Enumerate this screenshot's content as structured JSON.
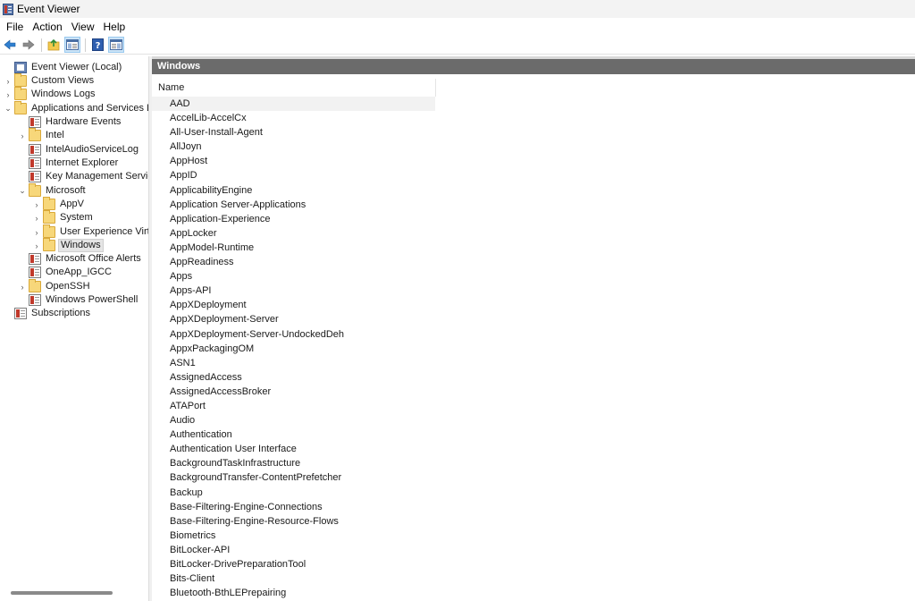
{
  "window": {
    "title": "Event Viewer",
    "icon": "event-viewer-icon"
  },
  "menu": [
    "File",
    "Action",
    "View",
    "Help"
  ],
  "toolbar": {
    "buttons": [
      "back-arrow-icon",
      "forward-arrow-icon",
      "up-folder-icon",
      "show-hide-tree-icon",
      "help-icon",
      "show-hide-action-pane-icon"
    ]
  },
  "tree": [
    {
      "label": "Event Viewer (Local)",
      "indent": 0,
      "expander": "",
      "icon": "event-viewer-icon"
    },
    {
      "label": "Custom Views",
      "indent": 0,
      "expander": "›",
      "icon": "folder-icon"
    },
    {
      "label": "Windows Logs",
      "indent": 0,
      "expander": "›",
      "icon": "folder-icon"
    },
    {
      "label": "Applications and Services Logs",
      "indent": 0,
      "expander": "⌄",
      "icon": "folder-icon"
    },
    {
      "label": "Hardware Events",
      "indent": 1,
      "expander": "",
      "icon": "log-icon"
    },
    {
      "label": "Intel",
      "indent": 1,
      "expander": "›",
      "icon": "folder-icon"
    },
    {
      "label": "IntelAudioServiceLog",
      "indent": 1,
      "expander": "",
      "icon": "log-icon"
    },
    {
      "label": "Internet Explorer",
      "indent": 1,
      "expander": "",
      "icon": "log-icon"
    },
    {
      "label": "Key Management Service",
      "indent": 1,
      "expander": "",
      "icon": "log-icon"
    },
    {
      "label": "Microsoft",
      "indent": 1,
      "expander": "⌄",
      "icon": "folder-icon"
    },
    {
      "label": "AppV",
      "indent": 2,
      "expander": "›",
      "icon": "folder-icon"
    },
    {
      "label": "System",
      "indent": 2,
      "expander": "›",
      "icon": "folder-icon"
    },
    {
      "label": "User Experience Virtualization",
      "indent": 2,
      "expander": "›",
      "icon": "folder-icon"
    },
    {
      "label": "Windows",
      "indent": 2,
      "expander": "›",
      "icon": "folder-icon",
      "selected": true
    },
    {
      "label": "Microsoft Office Alerts",
      "indent": 1,
      "expander": "",
      "icon": "log-icon"
    },
    {
      "label": "OneApp_IGCC",
      "indent": 1,
      "expander": "",
      "icon": "log-icon"
    },
    {
      "label": "OpenSSH",
      "indent": 1,
      "expander": "›",
      "icon": "folder-icon"
    },
    {
      "label": "Windows PowerShell",
      "indent": 1,
      "expander": "",
      "icon": "log-icon"
    },
    {
      "label": "Subscriptions",
      "indent": 0,
      "expander": "",
      "icon": "subscriptions-icon"
    }
  ],
  "content": {
    "header": "Windows",
    "column_name": "Name",
    "items": [
      "AAD",
      "AccelLib-AccelCx",
      "All-User-Install-Agent",
      "AllJoyn",
      "AppHost",
      "AppID",
      "ApplicabilityEngine",
      "Application Server-Applications",
      "Application-Experience",
      "AppLocker",
      "AppModel-Runtime",
      "AppReadiness",
      "Apps",
      "Apps-API",
      "AppXDeployment",
      "AppXDeployment-Server",
      "AppXDeployment-Server-UndockedDeh",
      "AppxPackagingOM",
      "ASN1",
      "AssignedAccess",
      "AssignedAccessBroker",
      "ATAPort",
      "Audio",
      "Authentication",
      "Authentication User Interface",
      "BackgroundTaskInfrastructure",
      "BackgroundTransfer-ContentPrefetcher",
      "Backup",
      "Base-Filtering-Engine-Connections",
      "Base-Filtering-Engine-Resource-Flows",
      "Biometrics",
      "BitLocker-API",
      "BitLocker-DrivePreparationTool",
      "Bits-Client",
      "Bluetooth-BthLEPrepairing"
    ]
  }
}
